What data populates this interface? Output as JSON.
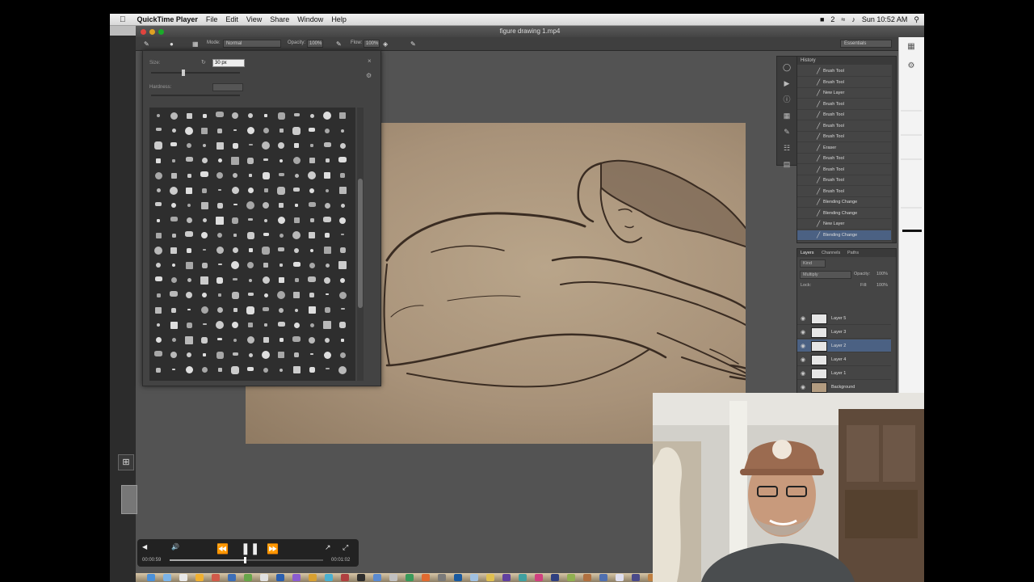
{
  "menubar": {
    "apple_icon": "apple-logo",
    "app_name": "QuickTime Player",
    "menus": [
      "File",
      "Edit",
      "View",
      "Share",
      "Window",
      "Help"
    ],
    "status_number": "2",
    "clock": "Sun 10:52 AM"
  },
  "window": {
    "title": "figure drawing 1.mp4"
  },
  "options_bar": {
    "mode_label": "Mode:",
    "mode_value": "Normal",
    "opacity_label": "Opacity:",
    "opacity_value": "100%",
    "flow_label": "Flow:",
    "flow_value": "100%",
    "workspace_value": "Essentials"
  },
  "brush_panel": {
    "size_label": "Size:",
    "size_value": "30 px",
    "hardness_label": "Hardness:"
  },
  "history": {
    "tab_label": "History",
    "items": [
      {
        "label": "Brush Tool",
        "selected": false
      },
      {
        "label": "Brush Tool",
        "selected": false
      },
      {
        "label": "New Layer",
        "selected": false
      },
      {
        "label": "Brush Tool",
        "selected": false
      },
      {
        "label": "Brush Tool",
        "selected": false
      },
      {
        "label": "Brush Tool",
        "selected": false
      },
      {
        "label": "Brush Tool",
        "selected": false
      },
      {
        "label": "Eraser",
        "selected": false
      },
      {
        "label": "Brush Tool",
        "selected": false
      },
      {
        "label": "Brush Tool",
        "selected": false
      },
      {
        "label": "Brush Tool",
        "selected": false
      },
      {
        "label": "Brush Tool",
        "selected": false
      },
      {
        "label": "Blending Change",
        "selected": false
      },
      {
        "label": "Blending Change",
        "selected": false
      },
      {
        "label": "New Layer",
        "selected": false
      },
      {
        "label": "Blending Change",
        "selected": true
      }
    ]
  },
  "layers": {
    "tabs": [
      "Layers",
      "Channels",
      "Paths"
    ],
    "kind_label": "Kind",
    "blend_mode": "Multiply",
    "opacity_label": "Opacity:",
    "opacity_value": "100%",
    "lock_label": "Lock:",
    "fill_label": "Fill:",
    "fill_value": "100%",
    "items": [
      {
        "name": "Layer 5",
        "selected": false
      },
      {
        "name": "Layer 3",
        "selected": false
      },
      {
        "name": "Layer 2",
        "selected": true
      },
      {
        "name": "Layer 4",
        "selected": false
      },
      {
        "name": "Layer 1",
        "selected": false
      },
      {
        "name": "Background",
        "selected": false
      }
    ]
  },
  "playback": {
    "elapsed": "00:00:59",
    "remaining": "00:01:02",
    "progress": 0.49
  },
  "icons": {
    "rewind": "rewind-icon",
    "pause": "pause-icon",
    "fast_forward": "fast-forward-icon",
    "share": "share-icon",
    "fullscreen": "fullscreen-icon",
    "volume": "volume-icon",
    "crop": "crop-icon",
    "gear": "gear-icon",
    "wifi": "wifi-icon",
    "search": "search-icon"
  }
}
